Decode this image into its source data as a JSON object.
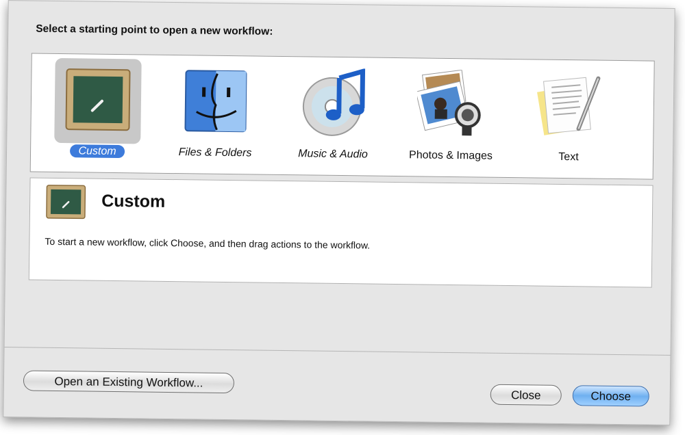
{
  "dialog": {
    "prompt": "Select a starting point to open a new workflow:"
  },
  "templates": [
    {
      "label": "Custom",
      "icon": "chalkboard-icon",
      "selected": true
    },
    {
      "label": "Files & Folders",
      "icon": "finder-icon",
      "selected": false
    },
    {
      "label": "Music & Audio",
      "icon": "itunes-icon",
      "selected": false
    },
    {
      "label": "Photos & Images",
      "icon": "iphoto-icon",
      "selected": false
    },
    {
      "label": "Text",
      "icon": "textedit-icon",
      "selected": false
    }
  ],
  "description": {
    "title": "Custom",
    "text": "To start a new workflow, click Choose, and then drag actions to the workflow."
  },
  "buttons": {
    "open_existing": "Open an Existing Workflow...",
    "close": "Close",
    "choose": "Choose"
  },
  "colors": {
    "selection": "#3d7bdb",
    "default_button": "#6fb0f0",
    "dialog_bg": "#e6e6e6"
  }
}
